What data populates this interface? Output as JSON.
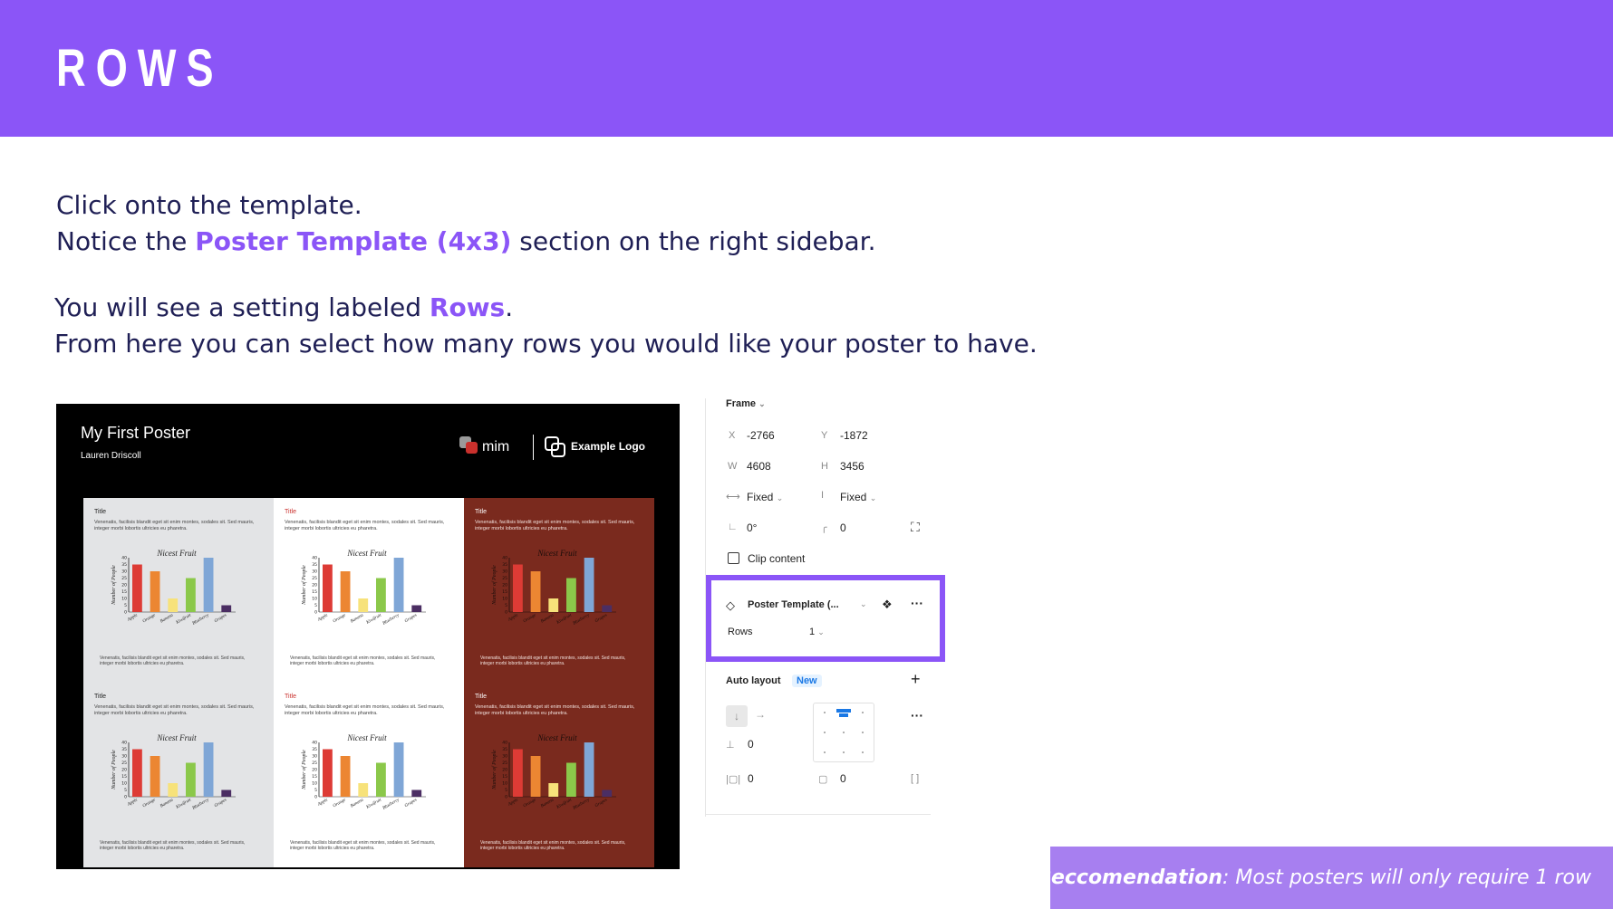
{
  "header": {
    "title": "ROWS"
  },
  "instructions": {
    "line1": "Click onto the template.",
    "line2_pre": "Notice the ",
    "line2_hl": "Poster Template (4x3)",
    "line2_post": " section on the right sidebar.",
    "line3_pre": "You will see a setting labeled ",
    "line3_hl": "Rows",
    "line3_post": ".",
    "line4": "From here you can select how many rows you would like your poster to have."
  },
  "poster": {
    "title": "My First Poster",
    "author": "Lauren Driscoll",
    "logo_primary": "mim",
    "logo_example": "Example Logo",
    "cells": [
      {
        "title": "Title",
        "body": "Venenatis, facilisis blandit eget sit enim montes, sodales sit. Sed mauris, integer morbi lobortis ultricies eu pharetra.",
        "footer": "Venenatis, facilisis blandit eget sit enim montes, sodales sit. Sed mauris, integer morbi lobortis ultricies eu pharetra.",
        "bg": "#e3e4e6",
        "title_color": "#222222"
      },
      {
        "title": "Title",
        "body": "Venenatis, facilisis blandit eget sit enim montes, sodales sit. Sed mauris, integer morbi lobortis ultricies eu pharetra.",
        "footer": "Venenatis, facilisis blandit eget sit enim montes, sodales sit. Sed mauris, integer morbi lobortis ultricies eu pharetra.",
        "bg": "#ffffff",
        "title_color": "#c9302c"
      },
      {
        "title": "Title",
        "body": "Venenatis, facilisis blandit eget sit enim montes, sodales sit. Sed mauris, integer morbi lobortis ultricies eu pharetra.",
        "footer": "Venenatis, facilisis blandit eget sit enim montes, sodales sit. Sed mauris, integer morbi lobortis ultricies eu pharetra.",
        "bg": "#7a2a1e",
        "title_color": "#ffffff"
      },
      {
        "title": "Title",
        "body": "Venenatis, facilisis blandit eget sit enim montes, sodales sit. Sed mauris, integer morbi lobortis ultricies eu pharetra.",
        "footer": "Venenatis, facilisis blandit eget sit enim montes, sodales sit. Sed mauris, integer morbi lobortis ultricies eu pharetra.",
        "bg": "#e3e4e6",
        "title_color": "#222222"
      },
      {
        "title": "Title",
        "body": "Venenatis, facilisis blandit eget sit enim montes, sodales sit. Sed mauris, integer morbi lobortis ultricies eu pharetra.",
        "footer": "Venenatis, facilisis blandit eget sit enim montes, sodales sit. Sed mauris, integer morbi lobortis ultricies eu pharetra.",
        "bg": "#ffffff",
        "title_color": "#c9302c"
      },
      {
        "title": "Title",
        "body": "Venenatis, facilisis blandit eget sit enim montes, sodales sit. Sed mauris, integer morbi lobortis ultricies eu pharetra.",
        "footer": "Venenatis, facilisis blandit eget sit enim montes, sodales sit. Sed mauris, integer morbi lobortis ultricies eu pharetra.",
        "bg": "#7a2a1e",
        "title_color": "#ffffff"
      }
    ]
  },
  "chart_data": {
    "type": "bar",
    "title": "Nicest Fruit",
    "ylabel": "Number of People",
    "xlabel": "",
    "categories": [
      "Apple",
      "Orange",
      "Banana",
      "Kiwifruit",
      "Blueberry",
      "Grapes"
    ],
    "values": [
      35,
      30,
      10,
      25,
      40,
      5
    ],
    "colors": [
      "#dd3b35",
      "#ec8632",
      "#f7e27a",
      "#8bc84a",
      "#7fa6d6",
      "#4b2e63"
    ],
    "ylim": [
      0,
      40
    ],
    "yticks": [
      "0",
      "5",
      "10",
      "15",
      "20",
      "25",
      "30",
      "35",
      "40"
    ]
  },
  "panel": {
    "frame_label": "Frame",
    "x_label": "X",
    "x_value": "-2766",
    "y_label": "Y",
    "y_value": "-1872",
    "w_label": "W",
    "w_value": "4608",
    "h_label": "H",
    "h_value": "3456",
    "w_mode": "Fixed",
    "h_mode": "Fixed",
    "rotation": "0°",
    "radius": "0",
    "clip_content": "Clip content",
    "component_name": "Poster Template (...",
    "rows_label": "Rows",
    "rows_value": "1",
    "auto_layout": "Auto layout",
    "new_badge": "New",
    "gap_value": "0",
    "padding_h": "0",
    "padding_v": "0"
  },
  "recommendation": {
    "bold": "Reccomendation",
    "text": ": Most posters will only require 1 row"
  },
  "colors": {
    "accent": "#8b55f7",
    "reco_bg": "#a77ff0",
    "text": "#1f1f55"
  }
}
